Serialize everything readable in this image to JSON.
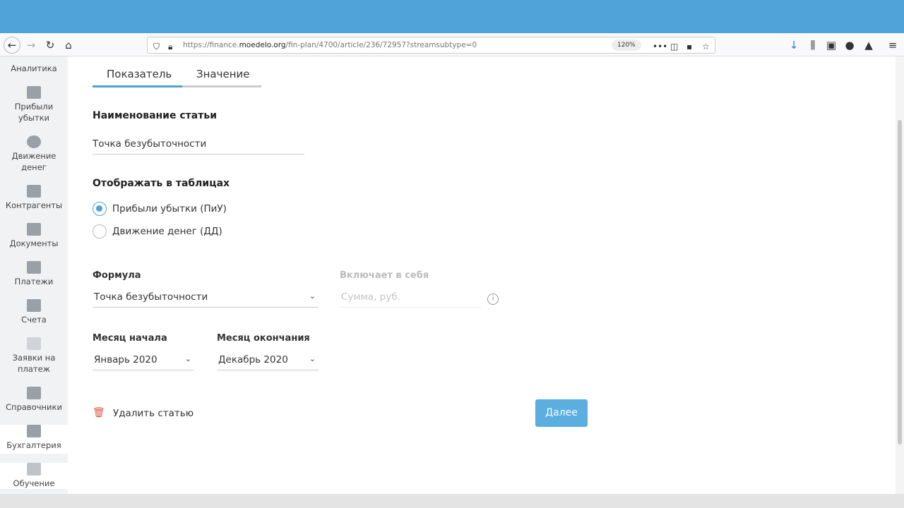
{
  "browser": {
    "url_prefix": "https://finance.",
    "url_domain": "moedelo.org",
    "url_path": "/fin-plan/4700/article/236/72957?streamsubtype=0",
    "zoom": "120%"
  },
  "sidebar": {
    "items": [
      {
        "label": "Аналитика"
      },
      {
        "label": "Прибыли убытки"
      },
      {
        "label": "Движение денег"
      },
      {
        "label": "Контрагенты"
      },
      {
        "label": "Документы"
      },
      {
        "label": "Платежи"
      },
      {
        "label": "Счета"
      },
      {
        "label": "Заявки на платеж"
      },
      {
        "label": "Справочники"
      },
      {
        "label": "Бухгалтерия"
      },
      {
        "label": "Обучение"
      }
    ]
  },
  "tabs": [
    {
      "label": "Показатель"
    },
    {
      "label": "Значение"
    }
  ],
  "form": {
    "name_label": "Наименование статьи",
    "name_value": "Точка безубыточности",
    "display_label": "Отображать в таблицах",
    "radio1": "Прибыли убытки (ПиУ)",
    "radio2": "Движение денег (ДД)",
    "formula_label": "Формула",
    "formula_value": "Точка безубыточности",
    "includes_label": "Включает в себя",
    "includes_placeholder": "Сумма, руб.",
    "start_label": "Месяц начала",
    "start_value": "Январь 2020",
    "end_label": "Месяц окончания",
    "end_value": "Декабрь 2020",
    "delete_label": "Удалить статью",
    "next_label": "Далее"
  },
  "colors": {
    "accent": "#4fa3d9",
    "button": "#5aaee0"
  }
}
